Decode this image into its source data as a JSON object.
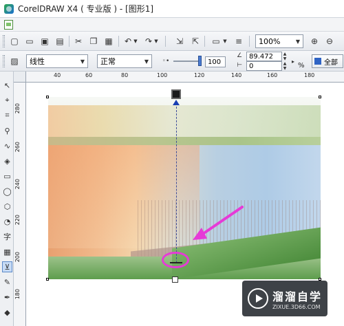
{
  "window": {
    "title": "CorelDRAW X4 ( 专业版 ) - [图形1]"
  },
  "toolbar": {
    "zoom_value": "100%",
    "transparency_type": "线性",
    "merge_mode": "正常",
    "edge_pad_value": "100",
    "angle_value": "89.472",
    "midpoint_value": "0",
    "percent_unit": "%",
    "all_label": "全部"
  },
  "ruler": {
    "horizontal_ticks": [
      "40",
      "60",
      "80",
      "100",
      "120",
      "140",
      "160",
      "180"
    ],
    "vertical_ticks": [
      "280",
      "260",
      "240",
      "220",
      "200",
      "180"
    ]
  },
  "annotation": {
    "arrow_color": "#e63ad7"
  },
  "watermark": {
    "brand": "溜溜自学",
    "url": "ZIXUE.3D66.COM"
  },
  "icons": [
    "new-icon",
    "open-icon",
    "save-icon",
    "print-icon",
    "cut-icon",
    "copy-icon",
    "paste-icon",
    "undo-icon",
    "redo-icon",
    "import-icon",
    "export-icon",
    "app-launcher-icon",
    "options-icon",
    "zoom-in-icon",
    "zoom-out-icon"
  ]
}
